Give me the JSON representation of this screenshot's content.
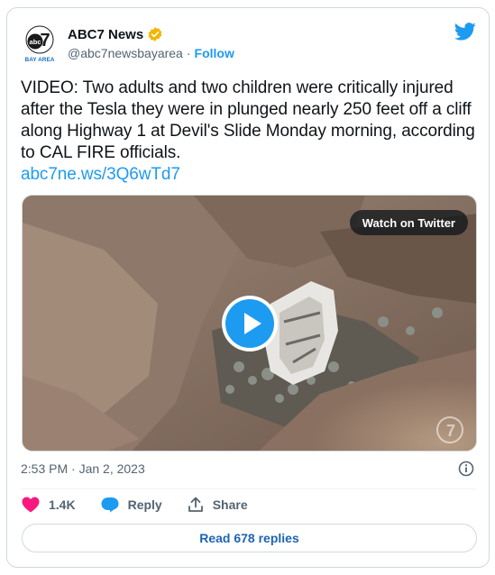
{
  "author": {
    "display_name": "ABC7 News",
    "handle": "@abc7newsbayarea",
    "separator": "·",
    "follow_label": "Follow",
    "avatar_logo": "7",
    "avatar_caption": "BAY AREA",
    "avatar_brand": "abc",
    "verified_color": "#f4b400"
  },
  "tweet": {
    "text": "VIDEO: Two adults and two children were critically injured after the Tesla they were in plunged nearly 250 feet off a cliff along Highway 1 at Devil's Slide Monday morning, according to CAL FIRE officials.",
    "link": "abc7ne.ws/3Q6wTd7"
  },
  "media": {
    "watch_label": "Watch on Twitter",
    "watermark": "7",
    "play_icon": "play-icon"
  },
  "meta": {
    "timestamp": "2:53 PM · Jan 2, 2023"
  },
  "actions": {
    "like_count": "1.4K",
    "reply_label": "Reply",
    "share_label": "Share",
    "like_color": "#f91880",
    "reply_color": "#1d9bf0"
  },
  "read_replies_label": "Read 678 replies",
  "colors": {
    "accent": "#1d9bf0",
    "text_secondary": "#536471",
    "border": "#cfd9de"
  }
}
